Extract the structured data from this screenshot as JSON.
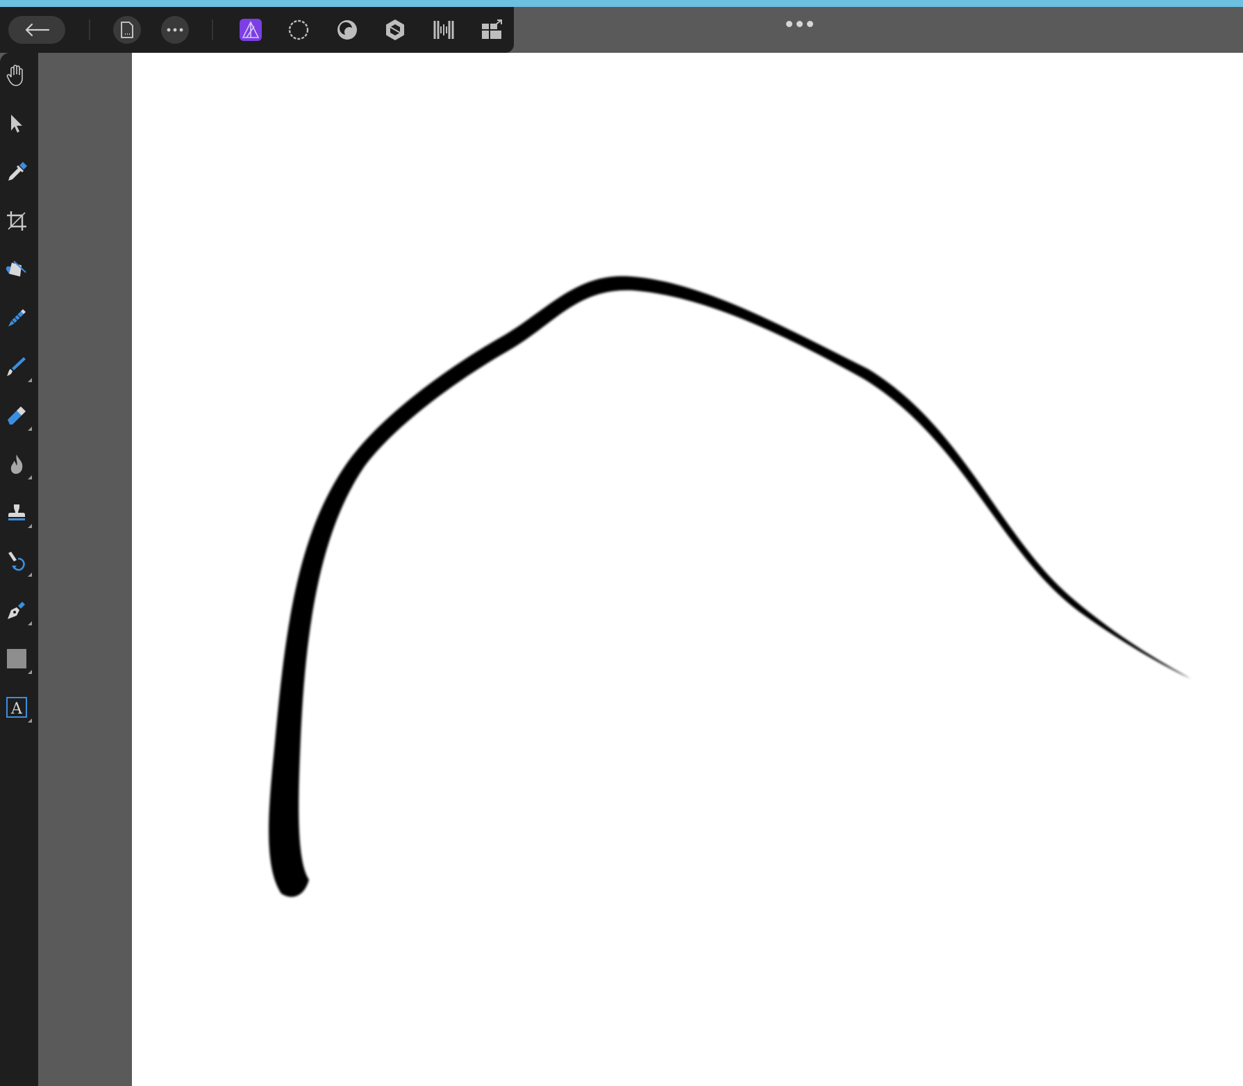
{
  "window": {
    "accent_color": "#6cc0e0",
    "bg_color": "#5a5a5a"
  },
  "topbar": {
    "back": {
      "icon": "arrow-left-icon"
    },
    "document": {
      "icon": "document-icon"
    },
    "more": {
      "icon": "ellipsis-icon"
    },
    "personas": [
      {
        "name": "photo",
        "icon": "photo-persona-icon",
        "active": true,
        "color": "#7b3fe4"
      },
      {
        "name": "liquify",
        "icon": "liquify-persona-icon",
        "active": false
      },
      {
        "name": "develop",
        "icon": "develop-persona-icon",
        "active": false
      },
      {
        "name": "tone-mapping",
        "icon": "tone-mapping-persona-icon",
        "active": false
      },
      {
        "name": "export",
        "icon": "export-persona-icon",
        "active": false
      },
      {
        "name": "studio",
        "icon": "studio-panels-icon",
        "active": false
      }
    ],
    "overflow": {
      "icon": "more-dots-icon"
    }
  },
  "tools": [
    {
      "name": "hand-tool",
      "icon": "hand-icon"
    },
    {
      "name": "move-tool",
      "icon": "pointer-icon"
    },
    {
      "name": "color-picker-tool",
      "icon": "eyedropper-icon"
    },
    {
      "name": "crop-tool",
      "icon": "crop-icon"
    },
    {
      "name": "flood-fill-tool",
      "icon": "paint-bucket-icon"
    },
    {
      "name": "selection-brush-tool",
      "icon": "selection-brush-icon"
    },
    {
      "name": "paint-brush-tool",
      "icon": "paint-brush-icon",
      "has_flyout": true
    },
    {
      "name": "erase-brush-tool",
      "icon": "eraser-icon",
      "has_flyout": true
    },
    {
      "name": "burn-brush-tool",
      "icon": "flame-icon",
      "has_flyout": true
    },
    {
      "name": "clone-tool",
      "icon": "stamp-icon",
      "has_flyout": true
    },
    {
      "name": "undo-brush-tool",
      "icon": "undo-brush-icon",
      "has_flyout": true
    },
    {
      "name": "pen-tool",
      "icon": "pen-nib-icon",
      "has_flyout": true
    },
    {
      "name": "rectangle-tool",
      "icon": "rectangle-icon",
      "has_flyout": true
    },
    {
      "name": "text-tool",
      "icon": "text-a-icon",
      "label": "A",
      "has_flyout": true
    }
  ],
  "canvas": {
    "background": "#ffffff",
    "stroke_color": "#000000"
  }
}
